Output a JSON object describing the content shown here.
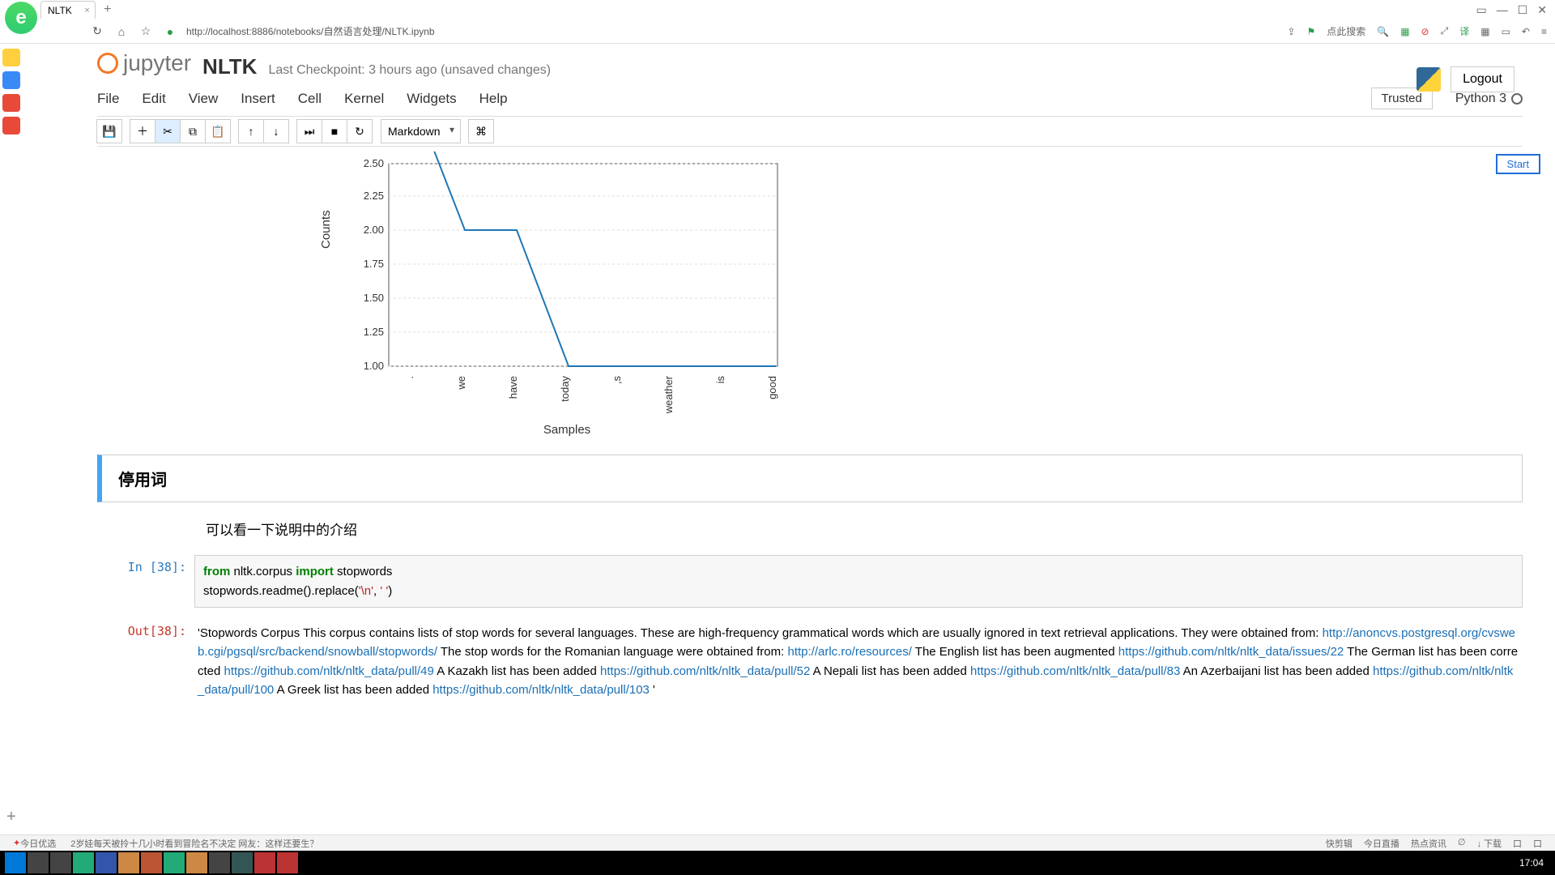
{
  "browser": {
    "tab_title": "NLTK",
    "url": "http://localhost:8886/notebooks/自然语言处理/NLTK.ipynb",
    "search_placeholder": "点此搜索"
  },
  "header": {
    "logo_text": "jupyter",
    "notebook_name": "NLTK",
    "checkpoint": "Last Checkpoint: 3 hours ago (unsaved changes)",
    "logout": "Logout",
    "trusted": "Trusted",
    "kernel": "Python 3",
    "start_btn": "Start"
  },
  "menu": {
    "items": [
      "File",
      "Edit",
      "View",
      "Insert",
      "Cell",
      "Kernel",
      "Widgets",
      "Help"
    ]
  },
  "toolbar": {
    "celltype": "Markdown"
  },
  "chart_data": {
    "type": "line",
    "title": "",
    "xlabel": "Samples",
    "ylabel": "Counts",
    "categories": [
      ".",
      "we",
      "have",
      "today",
      ",s",
      "weather",
      "is",
      "good"
    ],
    "values": [
      3.0,
      2.0,
      2.0,
      1.0,
      1.0,
      1.0,
      1.0,
      1.0
    ],
    "ylim": [
      1.0,
      2.5
    ],
    "yticks": [
      1.0,
      1.25,
      1.5,
      1.75,
      2.0,
      2.25,
      2.5
    ]
  },
  "cells": {
    "heading": "停用词",
    "note": "可以看一下说明中的介绍",
    "in_prompt": "In [38]:",
    "out_prompt": "Out[38]:",
    "code_line1_from": "from",
    "code_line1_mod": " nltk.corpus ",
    "code_line1_import": "import",
    "code_line1_rest": " stopwords",
    "code_line2_a": "stopwords.readme().replace(",
    "code_line2_s1": "'\\n'",
    "code_line2_b": ", ",
    "code_line2_s2": "' '",
    "code_line2_c": ")",
    "output_pre": "'Stopwords Corpus  This corpus contains lists of stop words for several languages.  These are high-frequency grammatical words which are usually ignored in text retrieval applications.  They were obtained from: ",
    "url1": "http://anoncvs.postgresql.org/cvsweb.cgi/pgsql/src/backend/snowball/stopwords/",
    "mid1": "  The stop words for the Romanian language were obtained from: ",
    "url2": "http://arlc.ro/resources/",
    "mid2": "  The English list has been augmented ",
    "url3": "https://github.com/nltk/nltk_data/issues/22",
    "mid3": "  The German list has been corrected ",
    "url4": "https://github.com/nltk/nltk_data/pull/49",
    "mid4": "  A Kazakh list has been added ",
    "url5": "https://github.com/nltk/nltk_data/pull/52",
    "mid5": "  A Nepali list has been added ",
    "url6": "https://github.com/nltk/nltk_data/pull/83",
    "mid6": "  An Azerbaijani list has been added ",
    "url7": "https://github.com/nltk/nltk_data/pull/100",
    "mid7": "  A Greek list has been added ",
    "url8": "https://github.com/nltk/nltk_data/pull/103",
    "tail": "  '"
  },
  "status": {
    "left1": "今日优选",
    "left2": "2岁娃每天被拎十几小时看到冒险名不决定 网友：这样还要生？",
    "r1": "快剪辑",
    "r2": "今日直播",
    "r3": "热点资讯",
    "r4": "∅",
    "r5": "↓ 下载",
    "r6": "口",
    "r7": "口",
    "time": "17:04"
  }
}
